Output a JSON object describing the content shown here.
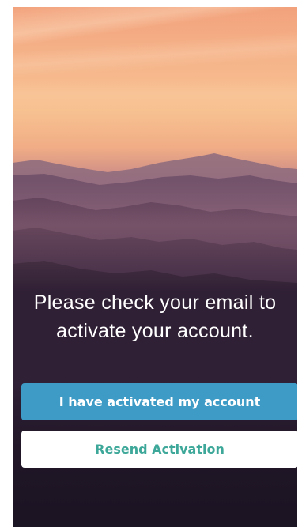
{
  "activation": {
    "message": "Please check your email to activate your account.",
    "activated_button_label": "I have activated my account",
    "resend_button_label": "Resend Activation"
  },
  "colors": {
    "primary_button": "#3e9bc6",
    "secondary_button_text": "#3da899",
    "secondary_button_bg": "#ffffff",
    "message_text": "#ffffff"
  },
  "background": {
    "image": "sunset-mountains-image"
  }
}
